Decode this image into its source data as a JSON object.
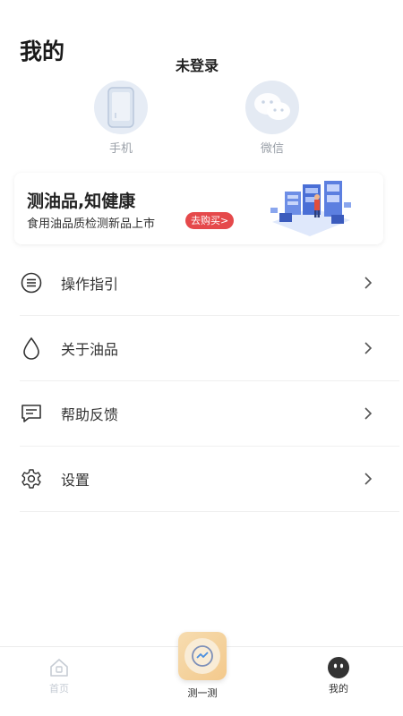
{
  "header": {
    "title": "我的",
    "login_status": "未登录"
  },
  "login_options": [
    {
      "label": "手机",
      "icon": "phone-icon"
    },
    {
      "label": "微信",
      "icon": "wechat-icon"
    }
  ],
  "banner": {
    "title": "测油品,知健康",
    "subtitle": "食用油品质检测新品上市",
    "button_label": "去购买>",
    "button_color": "#e5494b",
    "illustration": "shop-illustration"
  },
  "menu": {
    "items": [
      {
        "label": "操作指引",
        "icon": "list-icon"
      },
      {
        "label": "关于油品",
        "icon": "oil-drop-icon"
      },
      {
        "label": "帮助反馈",
        "icon": "feedback-icon"
      },
      {
        "label": "设置",
        "icon": "gear-icon"
      }
    ]
  },
  "tabbar": {
    "tabs": [
      {
        "label": "首页",
        "icon": "home-icon",
        "active": false
      },
      {
        "label": "测一测",
        "icon": "test-icon",
        "active": false
      },
      {
        "label": "我的",
        "icon": "user-face-icon",
        "active": true
      }
    ]
  }
}
